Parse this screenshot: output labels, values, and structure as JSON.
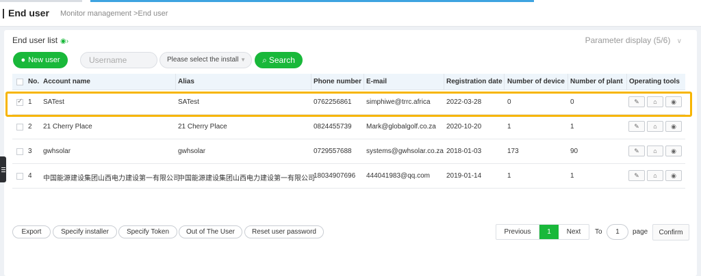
{
  "page": {
    "title": "End user",
    "breadcrumb": "Monitor management >End user"
  },
  "list": {
    "title": "End user list",
    "parameter_display": "Parameter display",
    "parameter_count": "(5/6)"
  },
  "toolbar": {
    "new_user_label": "New user",
    "username_placeholder": "Username",
    "install_select_value": "Please select the install",
    "search_label": "Search"
  },
  "table": {
    "columns": {
      "no": "No.",
      "account": "Account name",
      "alias": "Alias",
      "phone": "Phone number",
      "email": "E-mail",
      "reg_date": "Registration date",
      "devices": "Number of device",
      "plants": "Number of plant",
      "tools": "Operating tools"
    },
    "rows": [
      {
        "no": "1",
        "account": "SATest",
        "alias": "SATest",
        "phone": "0762256861",
        "email": "simphiwe@trrc.africa",
        "reg_date": "2022-03-28",
        "devices": "0",
        "plants": "0",
        "checked": true
      },
      {
        "no": "2",
        "account": "21 Cherry Place",
        "alias": "21 Cherry Place",
        "phone": "0824455739",
        "email": "Mark@globalgolf.co.za",
        "reg_date": "2020-10-20",
        "devices": "1",
        "plants": "1",
        "checked": false
      },
      {
        "no": "3",
        "account": "gwhsolar",
        "alias": "gwhsolar",
        "phone": "0729557688",
        "email": "systems@gwhsolar.co.za",
        "reg_date": "2018-01-03",
        "devices": "173",
        "plants": "90",
        "checked": false
      },
      {
        "no": "4",
        "account": "中国能源建设集团山西电力建设第一有限公司",
        "alias": "中国能源建设集团山西电力建设第一有限公司",
        "phone": "18034907696",
        "email": "444041983@qq.com",
        "reg_date": "2019-01-14",
        "devices": "1",
        "plants": "1",
        "checked": false
      }
    ]
  },
  "footer": {
    "export": "Export",
    "specify_installer": "Specify installer",
    "specify_token": "Specify Token",
    "out_of_user": "Out of The User",
    "reset_password": "Reset user password",
    "previous": "Previous",
    "current_page": "1",
    "next": "Next",
    "to": "To",
    "page_input": "1",
    "page_word": "page",
    "confirm": "Confirm"
  },
  "colors": {
    "accent_green": "#19b83a",
    "highlight": "#f7b500",
    "header_blue": "#3fa3e0"
  },
  "icons": [
    "user-icon",
    "search-icon",
    "eye-icon",
    "chevron-down-icon",
    "edit-icon",
    "home-icon",
    "view-icon",
    "menu-icon"
  ]
}
